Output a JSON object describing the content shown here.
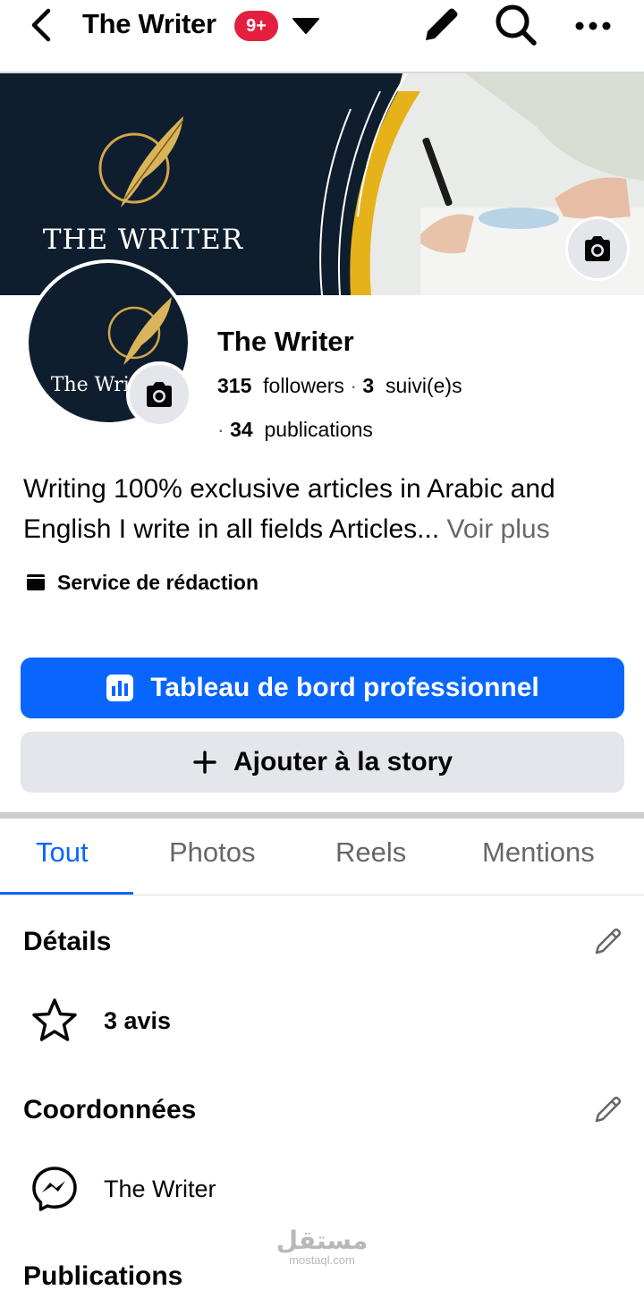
{
  "topbar": {
    "title": "The Writer",
    "notification_badge": "9+"
  },
  "cover": {
    "brand_text": "THE WRITER"
  },
  "avatar": {
    "brand_text": "The Writer"
  },
  "profile": {
    "name": "The Writer",
    "followers_count": "315",
    "followers_label": "followers",
    "separator": "·",
    "following_count": "3",
    "following_label": "suivi(e)s",
    "posts_count": "34",
    "posts_label": "publications"
  },
  "bio": {
    "text": "Writing 100% exclusive articles in Arabic and English I write in all fields Articles...",
    "see_more": "Voir plus"
  },
  "category": {
    "label": "Service de rédaction"
  },
  "buttons": {
    "dashboard_label": "Tableau de bord professionnel",
    "add_story_label": "Ajouter à la story"
  },
  "tabs": [
    {
      "label": "Tout",
      "active": true
    },
    {
      "label": "Photos",
      "active": false
    },
    {
      "label": "Reels",
      "active": false
    },
    {
      "label": "Mentions",
      "active": false
    }
  ],
  "details": {
    "title": "Détails",
    "reviews": "3 avis"
  },
  "contact": {
    "title": "Coordonnées",
    "messenger_name": "The Writer"
  },
  "publications": {
    "title": "Publications"
  },
  "watermark": {
    "arabic": "مستقل",
    "latin": "mostaql.com"
  },
  "colors": {
    "accent": "#0866ff",
    "badge": "#e41e3f",
    "secondary_button": "#e4e6eb",
    "muted_text": "#65676b",
    "cover_navy": "#0f1e2e",
    "cover_gold": "#e5b21a"
  },
  "icons": [
    "back-arrow-icon",
    "caret-down-icon",
    "pencil-icon",
    "search-icon",
    "more-icon",
    "camera-icon",
    "category-icon",
    "dashboard-icon",
    "plus-icon",
    "star-icon",
    "messenger-icon"
  ]
}
